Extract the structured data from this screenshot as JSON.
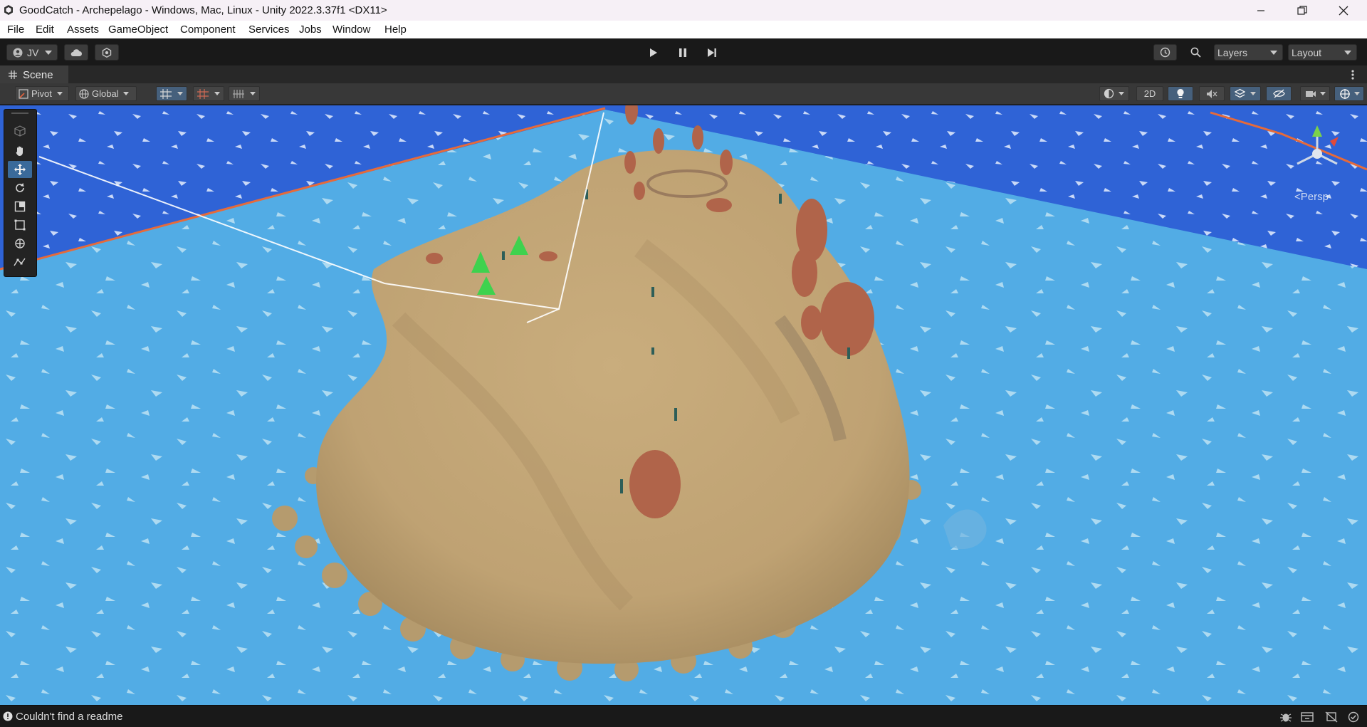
{
  "window": {
    "title": "GoodCatch - Archepelago - Windows, Mac, Linux - Unity 2022.3.37f1 <DX11>",
    "controls": [
      "minimize-icon",
      "restore-icon",
      "close-icon"
    ]
  },
  "menu": [
    "File",
    "Edit",
    "Assets",
    "GameObject",
    "Component",
    "Services",
    "Jobs",
    "Window",
    "Help"
  ],
  "toolbar": {
    "account": "JV",
    "layers": "Layers",
    "layout": "Layout"
  },
  "scene": {
    "tab_label": "Scene",
    "pivot": "Pivot",
    "global": "Global",
    "mode_2d": "2D",
    "camera_label": "<Persp"
  },
  "status": {
    "message": "Couldn't find a readme"
  },
  "colors": {
    "sea": "#55aee6",
    "deep_sea": "#2e5fd8",
    "sand": "#c8ac7c",
    "rock": "#b0644a",
    "tree": "#3ed24e",
    "accent": "#46607c"
  }
}
